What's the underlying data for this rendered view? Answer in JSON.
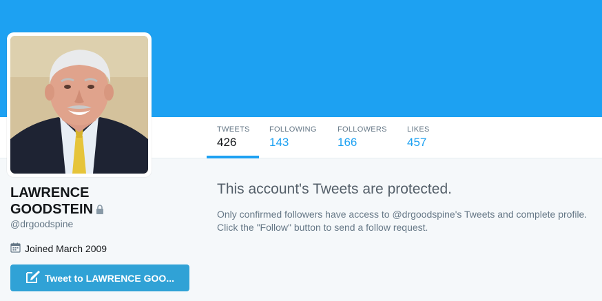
{
  "profile": {
    "name": "LAWRENCE GOODSTEIN",
    "name_line1": "LAWRENCE",
    "name_line2": "GOODSTEIN",
    "handle": "@drgoodspine",
    "joined": "Joined March 2009",
    "tweet_to_button": "Tweet to LAWRENCE GOO..."
  },
  "stats": [
    {
      "label": "TWEETS",
      "value": "426"
    },
    {
      "label": "FOLLOWING",
      "value": "143"
    },
    {
      "label": "FOLLOWERS",
      "value": "166"
    },
    {
      "label": "LIKES",
      "value": "457"
    }
  ],
  "protected": {
    "title": "This account's Tweets are protected.",
    "line1": "Only confirmed followers have access to @drgoodspine's Tweets and complete profile.",
    "line2": "Click the \"Follow\" button to send a follow request."
  },
  "colors": {
    "banner": "#1da1f2",
    "accent": "#1da1f2",
    "button": "#30a2d6"
  },
  "icons": {
    "lock": "lock-icon",
    "calendar": "calendar-icon",
    "compose": "compose-icon"
  }
}
